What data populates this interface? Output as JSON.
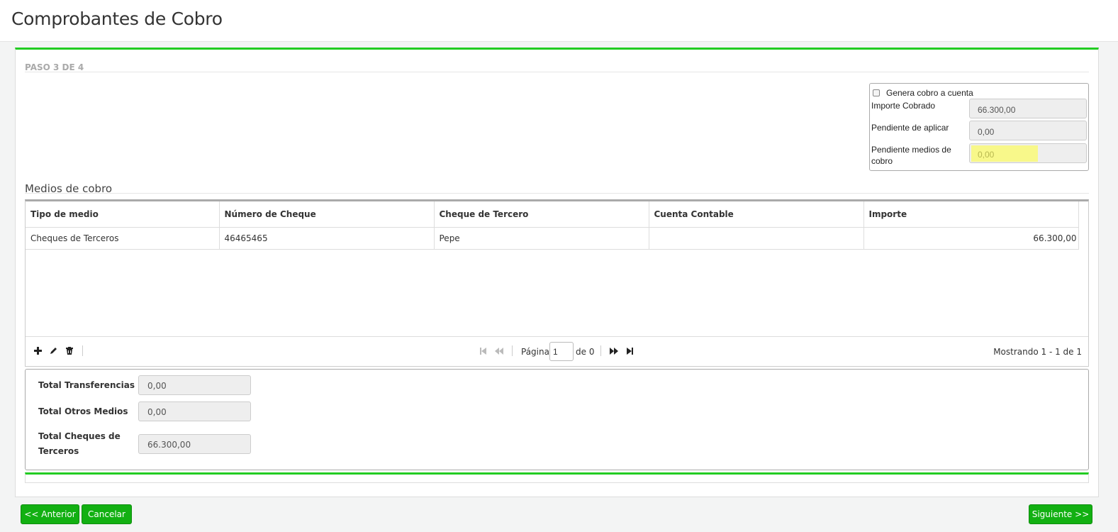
{
  "page": {
    "title": "Comprobantes de Cobro"
  },
  "wizard": {
    "step_label": "PASO 3 DE 4"
  },
  "summary": {
    "checkbox_label": "Genera cobro a cuenta",
    "importe_cobrado_label": "Importe Cobrado",
    "importe_cobrado_value": "66.300,00",
    "pendiente_aplicar_label": "Pendiente de aplicar",
    "pendiente_aplicar_value": "0,00",
    "pendiente_medios_label": "Pendiente medios de cobro",
    "pendiente_medios_value": "0,00"
  },
  "medios": {
    "title": "Medios de cobro",
    "columns": [
      "Tipo de medio",
      "Número de Cheque",
      "Cheque de Tercero",
      "Cuenta Contable",
      "Importe"
    ],
    "rows": [
      [
        "Cheques de Terceros",
        "46465465",
        "Pepe",
        "",
        "66.300,00"
      ]
    ]
  },
  "pager": {
    "page_label": "Página",
    "page_value": "1",
    "of_label": "de 0",
    "info": "Mostrando 1 - 1 de 1"
  },
  "totals": {
    "transferencias_label": "Total Transferencias",
    "transferencias_value": "0,00",
    "otros_label": "Total Otros Medios",
    "otros_value": "0,00",
    "cheques_label": "Total Cheques de Terceros",
    "cheques_value": "66.300,00"
  },
  "buttons": {
    "anterior": "<< Anterior",
    "cancelar": "Cancelar",
    "siguiente": "Siguiente >>"
  },
  "icons": {
    "add": "plus-icon",
    "edit": "pencil-icon",
    "delete": "trash-icon",
    "first": "first-page-icon",
    "prev": "prev-page-icon",
    "next": "next-page-icon",
    "last": "last-page-icon"
  },
  "colors": {
    "accent": "#22cc22",
    "button": "#12b012",
    "highlight": "#f8f88a"
  }
}
